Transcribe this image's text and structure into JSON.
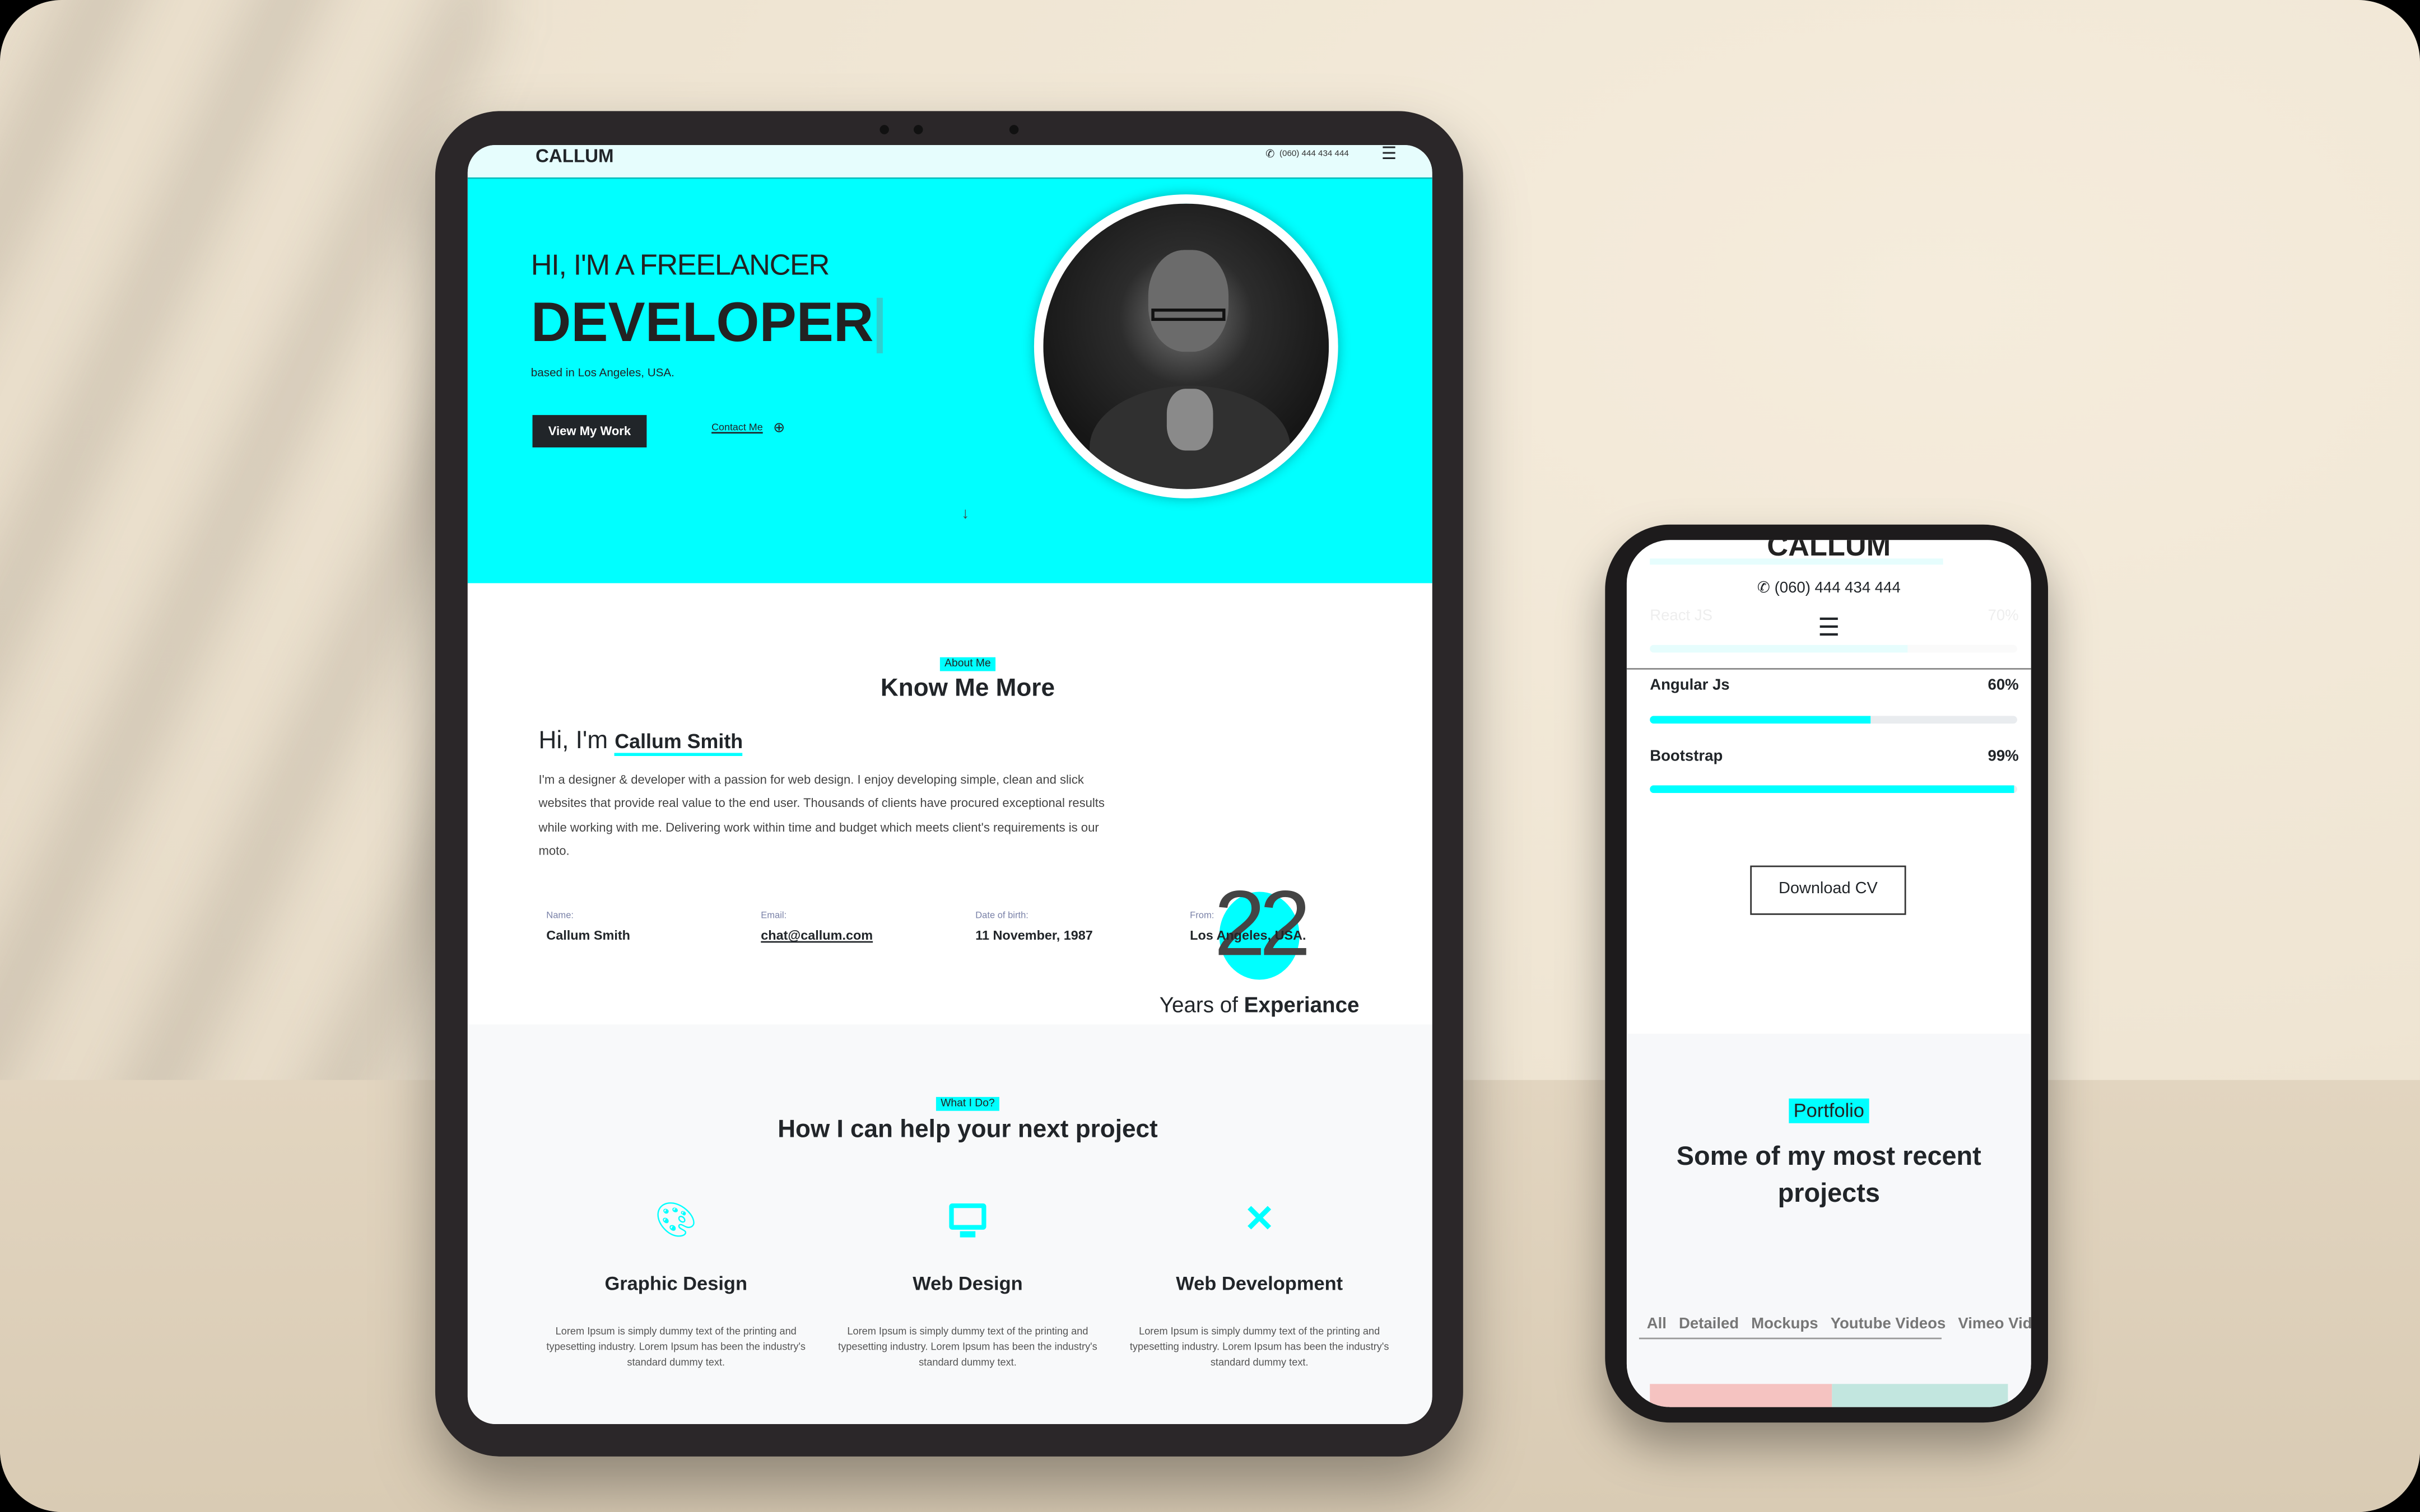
{
  "tablet": {
    "header": {
      "logo": "CALLUM",
      "phone": "(060) 444 434 444"
    },
    "hero": {
      "greeting": "HI, I'M A FREELANCER",
      "role": "DEVELOPER",
      "location": "based in Los Angeles, USA.",
      "primary_button": "View My Work",
      "secondary_link": "Contact Me"
    },
    "about": {
      "badge": "About Me",
      "title": "Know Me More",
      "hi": "Hi, I'm",
      "name": "Callum Smith",
      "bio": "I'm a designer & developer with a passion for web design. I enjoy developing simple, clean and slick websites that provide real value to the end user. Thousands of clients have procured exceptional results while working with me. Delivering work within time and budget which meets client's requirements is our moto.",
      "years": "22",
      "years_label": "Years of",
      "years_label_bold": "Experiance",
      "info": [
        {
          "label": "Name:",
          "value": "Callum Smith"
        },
        {
          "label": "Email:",
          "value": "chat@callum.com"
        },
        {
          "label": "Date of birth:",
          "value": "11 November, 1987"
        },
        {
          "label": "From:",
          "value": "Los Angeles, USA."
        }
      ]
    },
    "services": {
      "badge": "What I Do?",
      "title": "How I can help your next project",
      "items": [
        {
          "icon": "palette-icon",
          "title": "Graphic Design",
          "text": "Lorem Ipsum is simply dummy text of the printing and typesetting industry. Lorem Ipsum has been the industry's standard dummy text."
        },
        {
          "icon": "desktop-icon",
          "title": "Web Design",
          "text": "Lorem Ipsum is simply dummy text of the printing and typesetting industry. Lorem Ipsum has been the industry's standard dummy text."
        },
        {
          "icon": "pencil-ruler-icon",
          "title": "Web Development",
          "text": "Lorem Ipsum is simply dummy text of the printing and typesetting industry. Lorem Ipsum has been the industry's standard dummy text."
        }
      ]
    }
  },
  "phone": {
    "logo": "CALLUM",
    "phone": "(060) 444 434 444",
    "skills": [
      {
        "name": "React JS",
        "percent_label": "70%",
        "value": 70
      },
      {
        "name": "Angular Js",
        "percent_label": "60%",
        "value": 60
      },
      {
        "name": "Bootstrap",
        "percent_label": "99%",
        "value": 99
      }
    ],
    "download_button": "Download CV",
    "portfolio": {
      "badge": "Portfolio",
      "title": "Some of my most recent projects",
      "filters": [
        "All",
        "Detailed",
        "Mockups",
        "Youtube Videos",
        "Vimeo Videos"
      ]
    }
  },
  "colors": {
    "accent": "#00ffff",
    "dark": "#212529"
  }
}
